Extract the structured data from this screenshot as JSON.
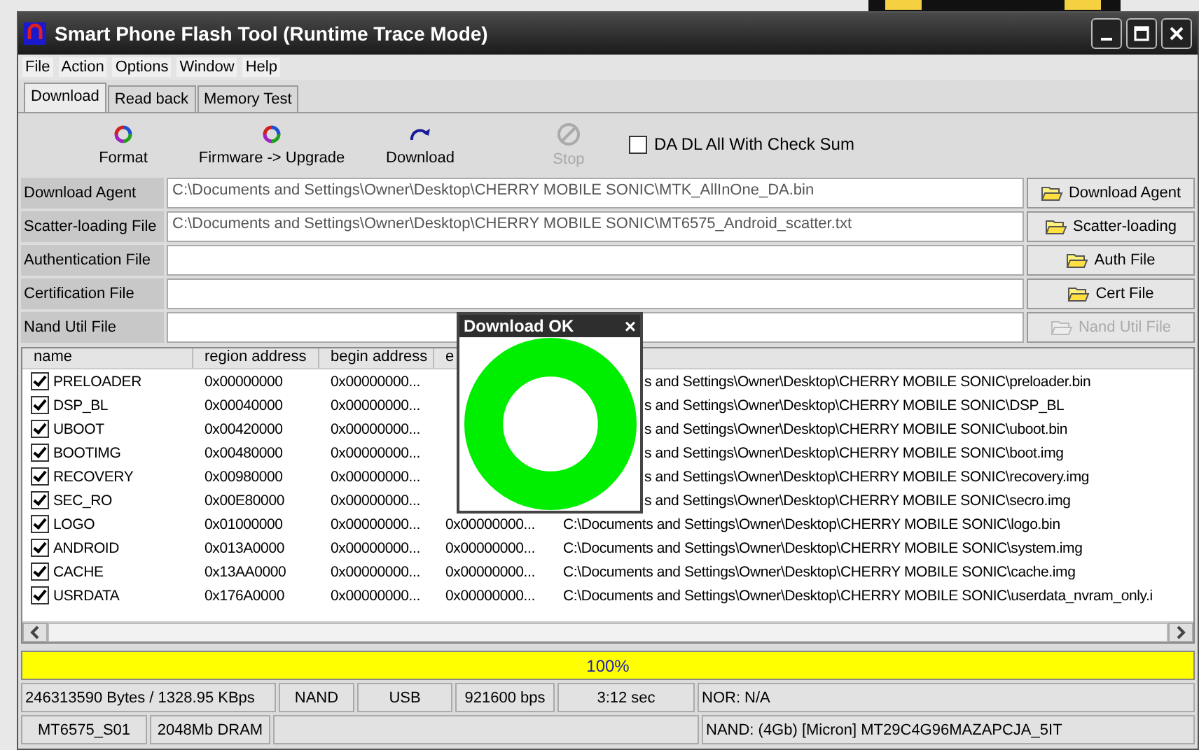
{
  "window": {
    "title": "Smart Phone Flash Tool (Runtime Trace Mode)"
  },
  "menu": [
    "File",
    "Action",
    "Options",
    "Window",
    "Help"
  ],
  "tabs": [
    {
      "label": "Download",
      "selected": true
    },
    {
      "label": "Read back",
      "selected": false
    },
    {
      "label": "Memory Test",
      "selected": false
    }
  ],
  "toolbar": [
    {
      "label": "Format",
      "kind": "format",
      "disabled": false
    },
    {
      "label": "Firmware -> Upgrade",
      "kind": "format",
      "disabled": false
    },
    {
      "label": "Download",
      "kind": "download",
      "disabled": false
    },
    {
      "label": "Stop",
      "kind": "stop",
      "disabled": true
    }
  ],
  "checksum": {
    "label": "DA DL All With Check Sum",
    "checked": false
  },
  "files": [
    {
      "label": "Download Agent",
      "value": "C:\\Documents and Settings\\Owner\\Desktop\\CHERRY MOBILE SONIC\\MTK_AllInOne_DA.bin",
      "button": "Download Agent",
      "disabled": false
    },
    {
      "label": "Scatter-loading File",
      "value": "C:\\Documents and Settings\\Owner\\Desktop\\CHERRY MOBILE SONIC\\MT6575_Android_scatter.txt",
      "button": "Scatter-loading",
      "disabled": false
    },
    {
      "label": "Authentication File",
      "button": "Auth File",
      "disabled": false
    },
    {
      "label": "Certification File",
      "button": "Cert File",
      "disabled": false
    },
    {
      "label": "Nand Util File",
      "button": "Nand Util File",
      "disabled": true
    }
  ],
  "table": {
    "columns": [
      "name",
      "region address",
      "begin address",
      "e"
    ],
    "rows": [
      {
        "name": "PRELOADER",
        "checked": true,
        "region": "0x00000000",
        "begin": "0x00000000...",
        "path": "s and Settings\\Owner\\Desktop\\CHERRY MOBILE SONIC\\preloader.bin"
      },
      {
        "name": "DSP_BL",
        "checked": true,
        "region": "0x00040000",
        "begin": "0x00000000...",
        "path": "s and Settings\\Owner\\Desktop\\CHERRY MOBILE SONIC\\DSP_BL"
      },
      {
        "name": "UBOOT",
        "checked": true,
        "region": "0x00420000",
        "begin": "0x00000000...",
        "path": "s and Settings\\Owner\\Desktop\\CHERRY MOBILE SONIC\\uboot.bin"
      },
      {
        "name": "BOOTIMG",
        "checked": true,
        "region": "0x00480000",
        "begin": "0x00000000...",
        "path": "s and Settings\\Owner\\Desktop\\CHERRY MOBILE SONIC\\boot.img"
      },
      {
        "name": "RECOVERY",
        "checked": true,
        "region": "0x00980000",
        "begin": "0x00000000...",
        "path": "s and Settings\\Owner\\Desktop\\CHERRY MOBILE SONIC\\recovery.img"
      },
      {
        "name": "SEC_RO",
        "checked": true,
        "region": "0x00E80000",
        "begin": "0x00000000...",
        "path": "s and Settings\\Owner\\Desktop\\CHERRY MOBILE SONIC\\secro.img"
      },
      {
        "name": "LOGO",
        "checked": true,
        "region": "0x01000000",
        "begin": "0x00000000...",
        "end": "0x00000000...",
        "path": "C:\\Documents and Settings\\Owner\\Desktop\\CHERRY MOBILE SONIC\\logo.bin"
      },
      {
        "name": "ANDROID",
        "checked": true,
        "region": "0x013A0000",
        "begin": "0x00000000...",
        "end": "0x00000000...",
        "path": "C:\\Documents and Settings\\Owner\\Desktop\\CHERRY MOBILE SONIC\\system.img"
      },
      {
        "name": "CACHE",
        "checked": true,
        "region": "0x13AA0000",
        "begin": "0x00000000...",
        "end": "0x00000000...",
        "path": "C:\\Documents and Settings\\Owner\\Desktop\\CHERRY MOBILE SONIC\\cache.img"
      },
      {
        "name": "USRDATA",
        "checked": true,
        "region": "0x176A0000",
        "begin": "0x00000000...",
        "end": "0x00000000...",
        "path": "C:\\Documents and Settings\\Owner\\Desktop\\CHERRY MOBILE SONIC\\userdata_nvram_only.i"
      }
    ]
  },
  "dialog": {
    "title": "Download OK",
    "close": "×"
  },
  "progress": {
    "level": 1,
    "text": "100%"
  },
  "status_bar": [
    [
      "246313590 Bytes / 1328.95 KBps",
      "NAND",
      "USB",
      "921600 bps",
      "3:12 sec",
      "NOR: N/A"
    ],
    [
      "MT6575_S01",
      "2048Mb DRAM",
      "NAND: (4Gb) [Micron] MT29C4G96MAZAPCJA_5IT"
    ]
  ]
}
